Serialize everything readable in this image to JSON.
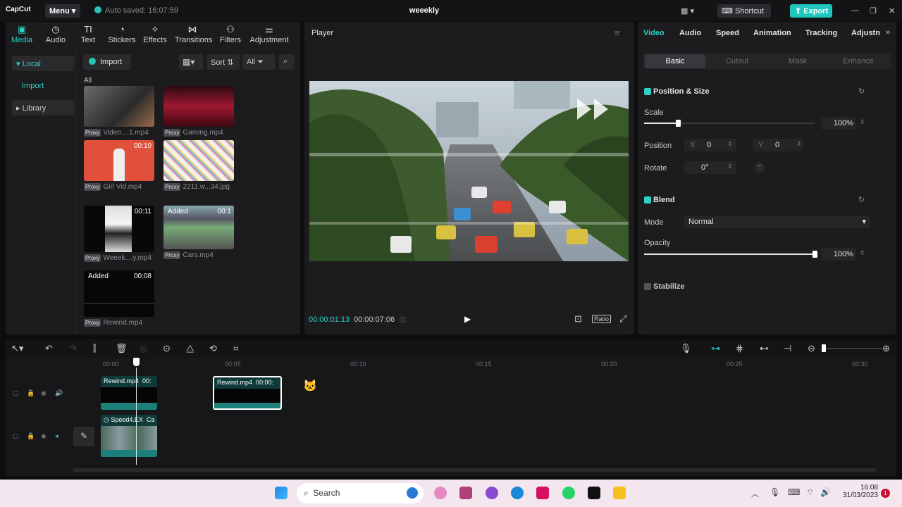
{
  "app": {
    "logo": "CapCut",
    "menu": "Menu",
    "autosave": "Auto saved: 16:07:59",
    "title": "weeekly",
    "shortcut": "Shortcut",
    "export": "Export"
  },
  "media_toolbar": [
    {
      "label": "Media",
      "icon": "media-icon"
    },
    {
      "label": "Audio",
      "icon": "audio-icon"
    },
    {
      "label": "Text",
      "icon": "text-icon"
    },
    {
      "label": "Stickers",
      "icon": "stickers-icon"
    },
    {
      "label": "Effects",
      "icon": "effects-icon"
    },
    {
      "label": "Transitions",
      "icon": "transitions-icon"
    },
    {
      "label": "Filters",
      "icon": "filters-icon"
    },
    {
      "label": "Adjustment",
      "icon": "adjustment-icon"
    }
  ],
  "sidebar": {
    "local": "Local",
    "import": "Import",
    "library": "Library"
  },
  "media_controls": {
    "import": "Import",
    "sort": "Sort",
    "all": "All",
    "section": "All"
  },
  "media_items": [
    {
      "name": "Video....1.mp4",
      "proxy": "Proxy",
      "duration": "",
      "added": ""
    },
    {
      "name": "Gaming.mp4",
      "proxy": "Proxy",
      "duration": "",
      "added": ""
    },
    {
      "name": "Girl Vid.mp4",
      "proxy": "Proxy",
      "duration": "00:10",
      "added": ""
    },
    {
      "name": "2211.w...34.jpg",
      "proxy": "Proxy",
      "duration": "",
      "added": ""
    },
    {
      "name": "Weeek....y.mp4",
      "proxy": "Proxy",
      "duration": "00:11",
      "added": ""
    },
    {
      "name": "Cars.mp4",
      "proxy": "Proxy",
      "duration": "00:1",
      "added": "Added"
    },
    {
      "name": "Rewind.mp4",
      "proxy": "Proxy",
      "duration": "00:08",
      "added": "Added"
    }
  ],
  "player": {
    "title": "Player",
    "current": "00:00:01:13",
    "total": "00:00:07:06",
    "ratio": "Ratio"
  },
  "props": {
    "tabs": [
      "Video",
      "Audio",
      "Speed",
      "Animation",
      "Tracking",
      "Adjustn"
    ],
    "subtabs": [
      "Basic",
      "Cutout",
      "Mask",
      "Enhance"
    ],
    "position_size": "Position & Size",
    "scale_label": "Scale",
    "scale_value": "100%",
    "scale_level": 0.2,
    "position_label": "Position",
    "x_label": "X",
    "x_value": "0",
    "y_label": "Y",
    "y_value": "0",
    "rotate_label": "Rotate",
    "rotate_value": "0°",
    "blend": "Blend",
    "mode_label": "Mode",
    "mode_value": "Normal",
    "opacity_label": "Opacity",
    "opacity_value": "100%",
    "opacity_level": 1.0,
    "stabilize": "Stabilize"
  },
  "timeline": {
    "ruler": [
      "00:00",
      "00:05",
      "00:10",
      "00:15",
      "00:20",
      "00:25",
      "00:30"
    ],
    "clips": [
      {
        "label": "Rewind.mp4",
        "dur": "00:"
      },
      {
        "label": "Rewind.mp4",
        "dur": "00:00:"
      },
      {
        "label": "Speed4.EX",
        "dur": "Ca"
      }
    ]
  },
  "taskbar": {
    "search": "Search",
    "time": "16:08",
    "date": "31/03/2023",
    "notif": "1"
  },
  "colors": {
    "accent": "#1fc6be",
    "bg": "#0d0d0f",
    "panel": "#1c1c1f"
  }
}
